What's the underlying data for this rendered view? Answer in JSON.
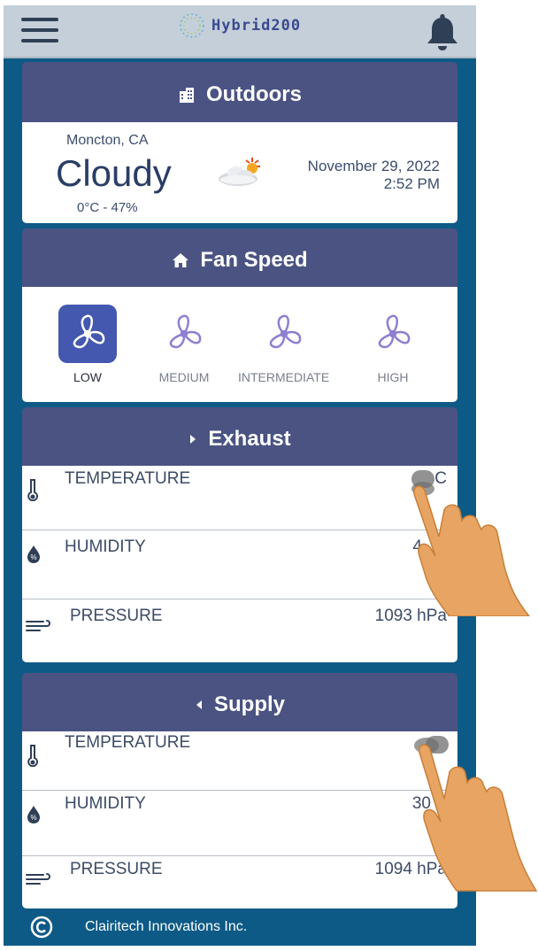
{
  "app": {
    "name": "Hybrid200"
  },
  "outdoors": {
    "title": "Outdoors",
    "city": "Moncton, CA",
    "condition": "Cloudy",
    "temp_range": "0°C - 47%",
    "date": "November 29, 2022",
    "time": "2:52 PM",
    "weather_icon": "partly-cloudy-icon"
  },
  "fan_speed": {
    "title": "Fan Speed",
    "selected": "LOW",
    "options": [
      "LOW",
      "MEDIUM",
      "INTERMEDIATE",
      "HIGH"
    ]
  },
  "exhaust": {
    "title": "Exhaust",
    "rows": [
      {
        "label": "TEMPERATURE",
        "value": "C",
        "icon": "thermometer-icon"
      },
      {
        "label": "HUMIDITY",
        "value": "4",
        "icon": "humidity-drop-icon"
      },
      {
        "label": "PRESSURE",
        "value": "1093 hPa",
        "icon": "wind-icon"
      }
    ]
  },
  "supply": {
    "title": "Supply",
    "rows": [
      {
        "label": "TEMPERATURE",
        "value": "",
        "icon": "thermometer-icon"
      },
      {
        "label": "HUMIDITY",
        "value": "30",
        "icon": "humidity-drop-icon"
      },
      {
        "label": "PRESSURE",
        "value": "1094 hPa",
        "icon": "wind-icon"
      }
    ]
  },
  "footer": {
    "text": "Clairitech Innovations Inc."
  },
  "colors": {
    "app_background": "#0e5a86",
    "header_bar": "#c5cfd9",
    "section_header": "#4a5382",
    "fan_active": "#4458b0",
    "fan_icon": "#8e7fd0",
    "hand": "#e8a462"
  }
}
